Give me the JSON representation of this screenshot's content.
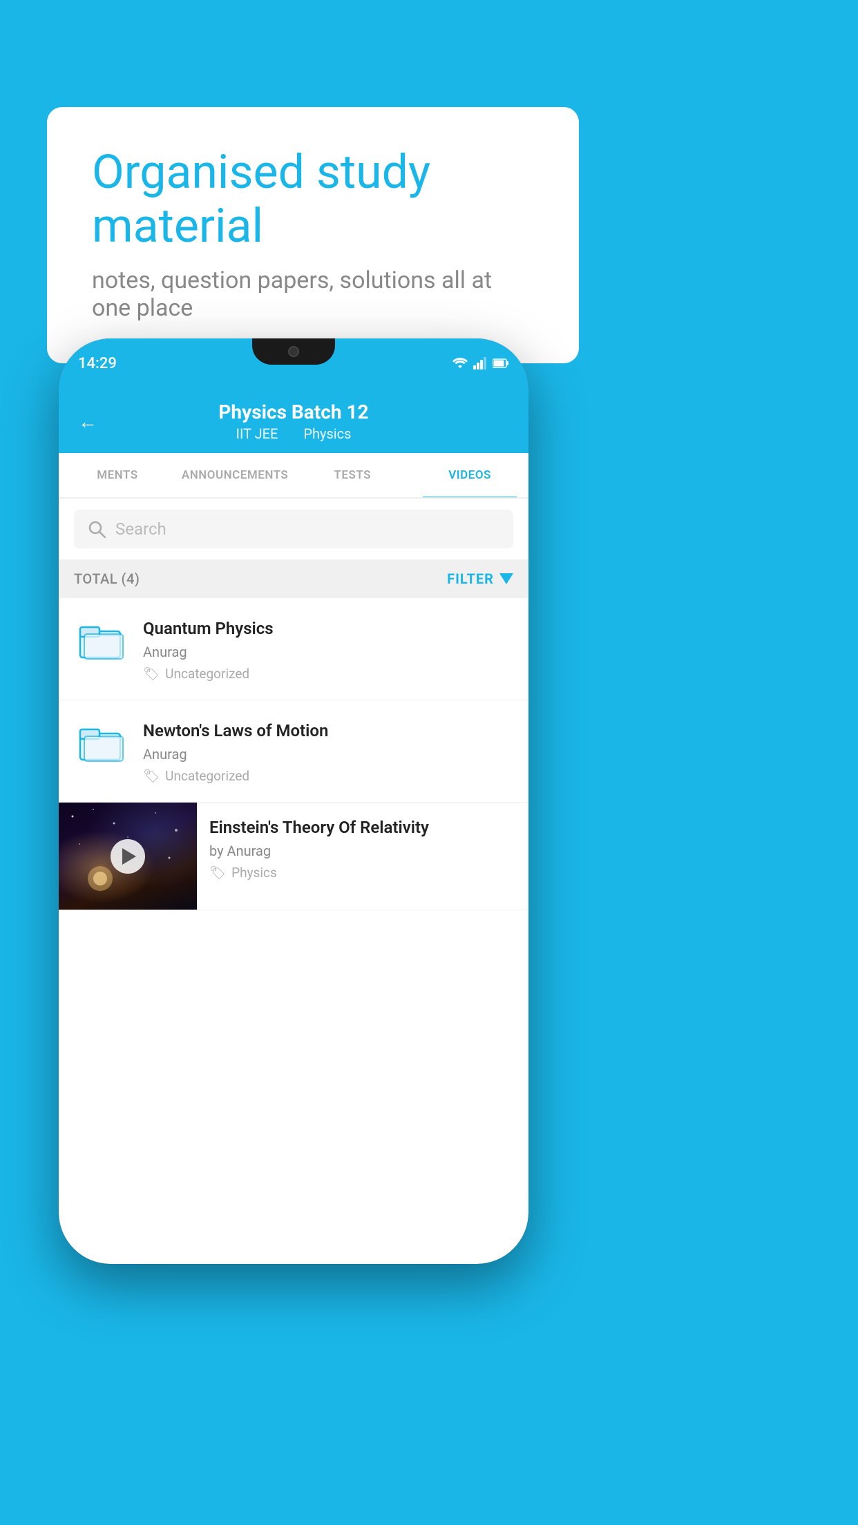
{
  "background_color": "#1ab6e8",
  "speech_bubble": {
    "heading": "Organised study material",
    "subtext": "notes, question papers, solutions all at one place"
  },
  "phone": {
    "time": "14:29",
    "header": {
      "back_label": "←",
      "title": "Physics Batch 12",
      "subtitle_part1": "IIT JEE",
      "subtitle_part2": "Physics"
    },
    "tabs": [
      {
        "label": "MENTS",
        "active": false
      },
      {
        "label": "ANNOUNCEMENTS",
        "active": false
      },
      {
        "label": "TESTS",
        "active": false
      },
      {
        "label": "VIDEOS",
        "active": true
      }
    ],
    "search": {
      "placeholder": "Search"
    },
    "filter_bar": {
      "total_label": "TOTAL (4)",
      "filter_label": "FILTER"
    },
    "videos": [
      {
        "id": "quantum",
        "title": "Quantum Physics",
        "author": "Anurag",
        "tag": "Uncategorized",
        "has_thumb": false
      },
      {
        "id": "newton",
        "title": "Newton's Laws of Motion",
        "author": "Anurag",
        "tag": "Uncategorized",
        "has_thumb": false
      },
      {
        "id": "einstein",
        "title": "Einstein's Theory Of Relativity",
        "author": "by Anurag",
        "tag": "Physics",
        "has_thumb": true
      }
    ]
  }
}
